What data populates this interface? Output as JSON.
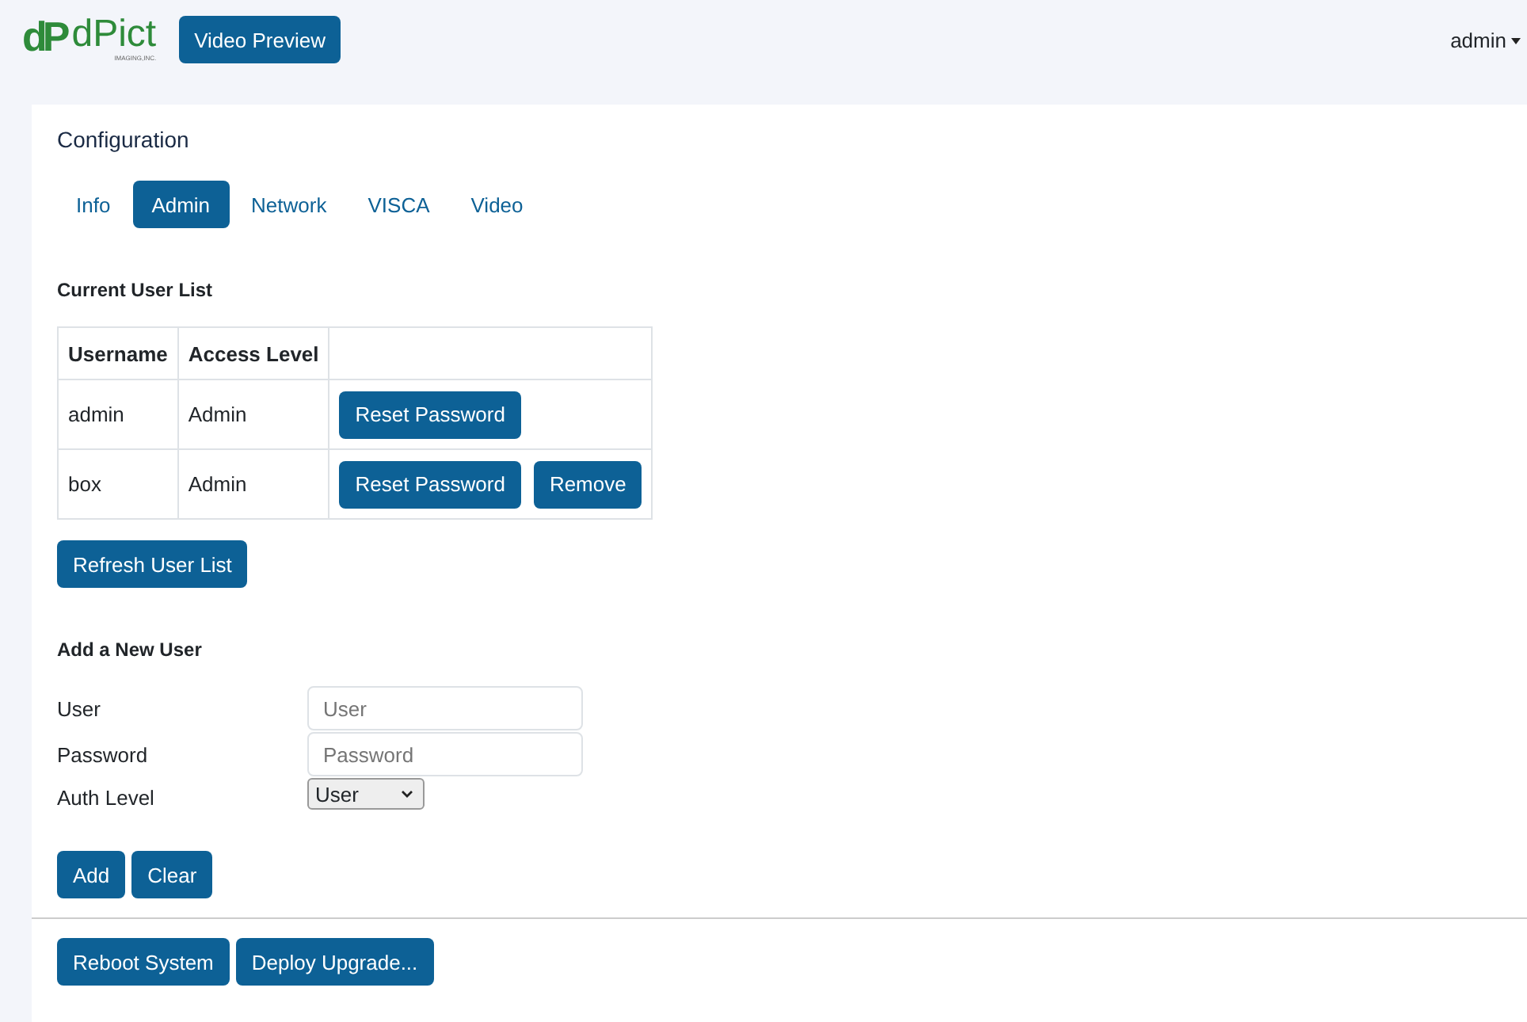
{
  "header": {
    "logo": {
      "mark": "dP",
      "name": "dPict",
      "tagline": "IMAGING,INC."
    },
    "nav_button": "Video Preview",
    "user_menu": "admin"
  },
  "configuration": {
    "title": "Configuration",
    "tabs": [
      {
        "label": "Info",
        "selected": false
      },
      {
        "label": "Admin",
        "selected": true
      },
      {
        "label": "Network",
        "selected": false
      },
      {
        "label": "VISCA",
        "selected": false
      },
      {
        "label": "Video",
        "selected": false
      }
    ],
    "user_list": {
      "title": "Current User List",
      "columns": [
        "Username",
        "Access Level"
      ],
      "rows": [
        {
          "username": "admin",
          "access_level": "Admin",
          "actions": [
            "Reset Password"
          ]
        },
        {
          "username": "box",
          "access_level": "Admin",
          "actions": [
            "Reset Password",
            "Remove"
          ]
        }
      ],
      "refresh_button": "Refresh User List"
    },
    "add_user": {
      "title": "Add a New User",
      "fields": [
        {
          "label": "User",
          "kind": "text",
          "placeholder": "User"
        },
        {
          "label": "Password",
          "kind": "password",
          "placeholder": "Password"
        },
        {
          "label": "Auth Level",
          "kind": "select",
          "value": "User"
        }
      ],
      "buttons": [
        "Add",
        "Clear"
      ]
    },
    "system_buttons": [
      "Reboot System",
      "Deploy Upgrade..."
    ]
  }
}
